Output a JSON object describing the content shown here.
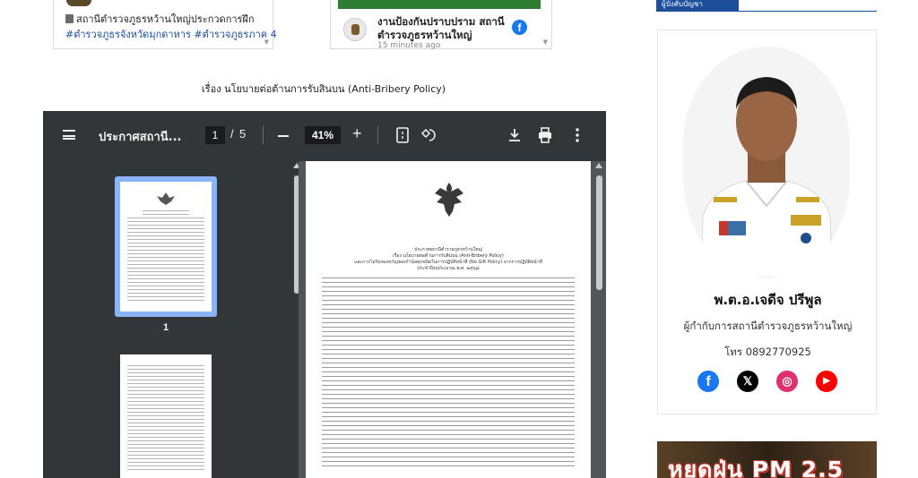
{
  "feed": {
    "card1": {
      "line1": "สถานีตำรวจภูธรหว้านใหญ่ประกวดการฝึก",
      "line2": "#ตำรวจภูธรจังหวัดมุกดาหาร #ตำรวจภูธรภาค 4"
    },
    "card2": {
      "title": "งานป้องกันปราบปราม สถานีตำรวจภูธรหว้านใหญ่",
      "time": "15 minutes ago"
    }
  },
  "document": {
    "caption": "เรื่อง นโยบายต่อต้านการรับสินบน (Anti-Bribery Policy)"
  },
  "pdf_viewer": {
    "title": "ประกาศสถานี...",
    "current_page": "1",
    "page_separator": "/",
    "total_pages": "5",
    "zoom": "41%",
    "thumbnail_label": "1",
    "page_heading": [
      "ประกาศสถานีตำรวจภูธรหว้านใหญ่",
      "เรื่อง นโยบายต่อต้านการรับสินบน (Anti-Bribery Policy)",
      "และการไม่รับของขวัญของกำนัลทุกชนิดในการปฏิบัติหน้าที่ (No Gift Policy) จากการปฏิบัติหน้าที่",
      "ประจำปีงบประมาณ พ.ศ. ๒๕๖๘"
    ]
  },
  "sidebar_widget": {
    "tab_label": "ผู้บังคับบัญชา"
  },
  "profile": {
    "name": "พ.ต.อ.เจดีจ ปรีพูล",
    "role": "ผู้กำกับการสถานีตำรวจภูธรหว้านใหญ่",
    "phone": "โทร 0892770925"
  },
  "banner": {
    "text": "หยุดฝุ่น PM 2.5"
  },
  "colors": {
    "toolbar": "#323639",
    "viewer_bg": "#525659",
    "accent_blue": "#1c4e9a",
    "facebook": "#1877f2",
    "instagram": "#e1306c",
    "youtube": "#ff0000"
  }
}
